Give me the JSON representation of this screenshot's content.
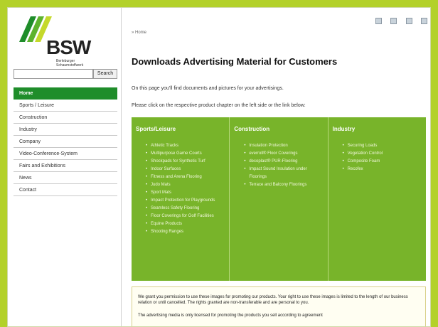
{
  "brand": {
    "name": "BSW",
    "subtitle": "Berleburger Schaumstoffwerk",
    "colors": {
      "green": "#78b42a",
      "dark_green": "#1f8d2a",
      "lime": "#b3d12a"
    }
  },
  "search": {
    "placeholder": "",
    "button_label": "Search"
  },
  "nav": {
    "items": [
      {
        "label": "Home",
        "active": true
      },
      {
        "label": "Sports / Leisure"
      },
      {
        "label": "Construction"
      },
      {
        "label": "Industry"
      },
      {
        "label": "Company"
      },
      {
        "label": "Video-Conference-System"
      },
      {
        "label": "Fairs and Exhibitions"
      },
      {
        "label": "News"
      },
      {
        "label": "Contact"
      }
    ]
  },
  "toolbar": {
    "icons": [
      "print-icon",
      "email-icon",
      "font-size-icon",
      "bookmark-icon"
    ]
  },
  "main": {
    "breadcrumb": "» Home",
    "title": "Downloads Advertising Material for Customers",
    "intro1": "On this page you'll find documents and pictures for your advertisings.",
    "intro2": "Please click on the respective product chapter on the left side or the link below:",
    "categories": [
      {
        "title": "Sports/Leisure",
        "items": [
          "Athletic Tracks",
          "Multipurpose Game Courts",
          "Shockpads for Synthetic Turf",
          "Indoor Surfaces",
          "Fitness and Arena Flooring",
          "Judo Mats",
          "Sport Mats",
          "Impact Protection for Playgrounds",
          "Seamless Safety Flooring",
          "Floor Coverings for Golf Facilities",
          "Equine Products",
          "Shooting Ranges"
        ]
      },
      {
        "title": "Construction",
        "items": [
          "Insulation Protection",
          "everroll® Floor Coverings",
          "decoplast® PUR-Flooring",
          "Impact Sound Insulation under Floorings",
          "Terrace and Balcony Floorings"
        ]
      },
      {
        "title": "Industry",
        "items": [
          "Securing Loads",
          "Vegetation Control",
          "Composite Foam",
          "Recofex"
        ]
      }
    ],
    "notice": {
      "p1": "We grant you permission to use these images for promoting our products. Your right to use these images is limited to the length of our business relation or until cancelled. The rights granted are non-transferable and are personal to you.",
      "p2": "The advertising media is only licensed for promoting the products you sell according to agreement"
    }
  }
}
